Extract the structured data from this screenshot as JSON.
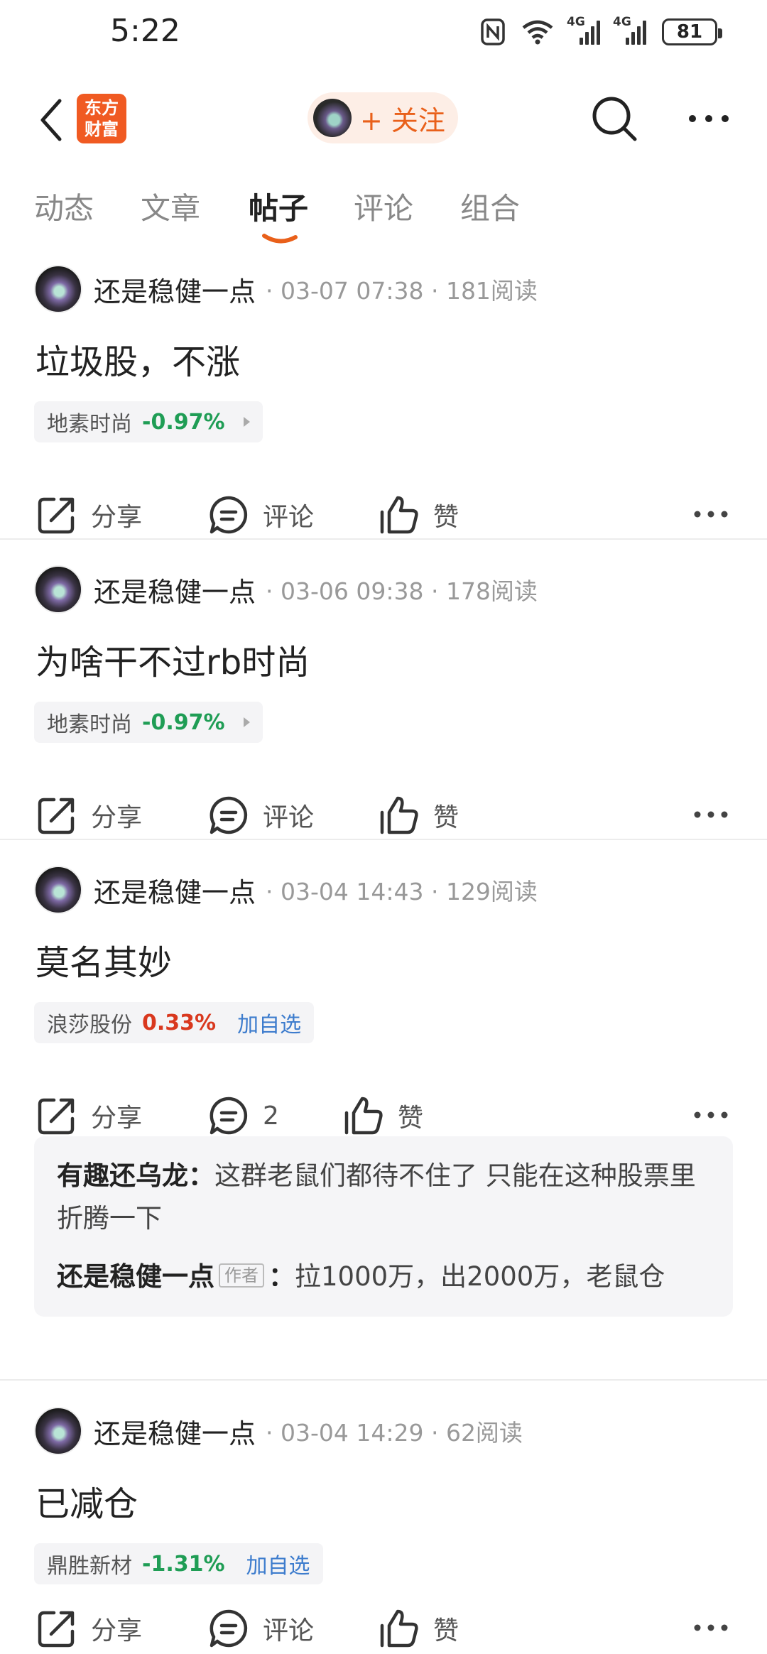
{
  "status": {
    "time": "5:22",
    "battery": "81",
    "net1": "4G",
    "net2": "4G"
  },
  "header": {
    "logo_line1": "东方",
    "logo_line2": "财富",
    "follow_label": "+ 关注"
  },
  "tabs": [
    "动态",
    "文章",
    "帖子",
    "评论",
    "组合"
  ],
  "active_tab": "帖子",
  "colors": {
    "accent": "#e9601a",
    "down": "#1f9d55",
    "up": "#d9381e",
    "link": "#3d7ccd"
  },
  "posts": [
    {
      "author": "还是稳健一点",
      "meta": "· 03-07 07:38 · 181阅读",
      "title": "垃圾股，不涨",
      "stock": {
        "name": "地素时尚",
        "change": "-0.97%",
        "direction": "down"
      },
      "actions": {
        "share": "分享",
        "comment": "评论",
        "like": "赞"
      }
    },
    {
      "author": "还是稳健一点",
      "meta": "· 03-06 09:38 · 178阅读",
      "title": "为啥干不过rb时尚",
      "stock": {
        "name": "地素时尚",
        "change": "-0.97%",
        "direction": "down"
      },
      "actions": {
        "share": "分享",
        "comment": "评论",
        "like": "赞"
      }
    },
    {
      "author": "还是稳健一点",
      "meta": "· 03-04 14:43 · 129阅读",
      "title": "莫名其妙",
      "stock": {
        "name": "浪莎股份",
        "change": "0.33%",
        "direction": "up",
        "add": "加自选"
      },
      "actions": {
        "share": "分享",
        "comment": "2",
        "like": "赞"
      },
      "comments": [
        {
          "user": "有趣还乌龙",
          "text": "这群老鼠们都待不住了 只能在这种股票里折腾一下"
        },
        {
          "user": "还是稳健一点",
          "badge": "作者",
          "text": "拉1000万，出2000万，老鼠仓"
        }
      ]
    },
    {
      "author": "还是稳健一点",
      "meta": "· 03-04 14:29 · 62阅读",
      "title": "已减仓",
      "stock": {
        "name": "鼎胜新材",
        "change": "-1.31%",
        "direction": "down",
        "add": "加自选"
      },
      "actions": {
        "share": "分享",
        "comment": "评论",
        "like": "赞"
      }
    }
  ]
}
